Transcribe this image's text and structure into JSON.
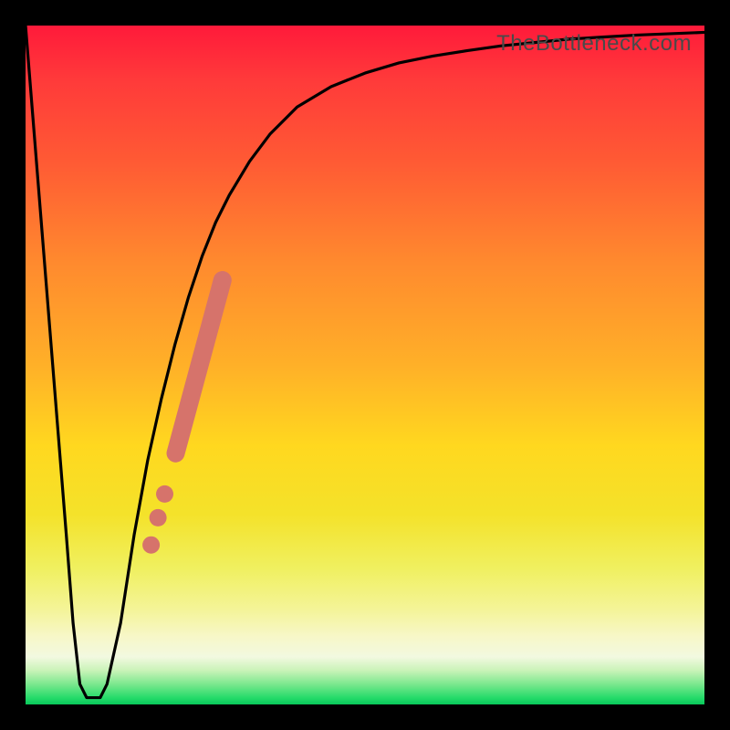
{
  "watermark": "TheBottleneck.com",
  "chart_data": {
    "type": "line",
    "title": "",
    "xlabel": "",
    "ylabel": "",
    "xlim": [
      0,
      100
    ],
    "ylim": [
      0,
      100
    ],
    "series": [
      {
        "name": "bottleneck-curve",
        "x": [
          0,
          2,
          4,
          6,
          7,
          8,
          9,
          10,
          11,
          12,
          14,
          16,
          18,
          20,
          22,
          24,
          26,
          28,
          30,
          33,
          36,
          40,
          45,
          50,
          55,
          60,
          65,
          70,
          75,
          80,
          85,
          90,
          95,
          100
        ],
        "y": [
          100,
          75,
          50,
          25,
          12,
          3,
          1,
          1,
          1,
          3,
          12,
          25,
          36,
          45,
          53,
          60,
          66,
          71,
          75,
          80,
          84,
          88,
          91,
          93,
          94.5,
          95.5,
          96.3,
          97,
          97.5,
          98,
          98.3,
          98.6,
          98.8,
          99
        ]
      }
    ],
    "highlight_segment": {
      "name": "critical-range",
      "points": [
        {
          "x": 18.5,
          "y": 23.5
        },
        {
          "x": 19.5,
          "y": 27.5
        },
        {
          "x": 20.5,
          "y": 31.5
        },
        {
          "x": 22.0,
          "y": 37.0
        },
        {
          "x": 25.6,
          "y": 50.5
        },
        {
          "x": 29.0,
          "y": 62.5
        }
      ],
      "color": "#d6736b"
    },
    "background_gradient": {
      "top": "#ff1a3a",
      "mid": "#ffd81f",
      "bottom": "#08c85a"
    }
  }
}
